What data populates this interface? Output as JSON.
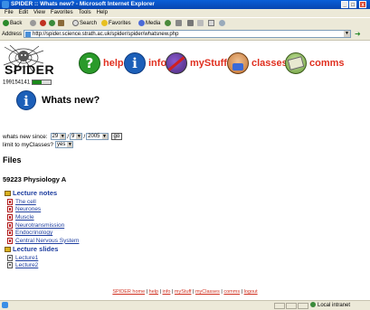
{
  "window": {
    "title": "SPIDER :: Whats new? - Microsoft Internet Explorer"
  },
  "menu": [
    "File",
    "Edit",
    "View",
    "Favorites",
    "Tools",
    "Help"
  ],
  "toolbar": {
    "back": "Back",
    "search": "Search",
    "favorites": "Favorites",
    "media": "Media"
  },
  "address": {
    "label": "Address",
    "url": "http://spider.science.strath.ac.uk/spider/spider/whatsnew.php"
  },
  "status": {
    "zone": "Local intranet"
  },
  "site": {
    "logo_text": "SPIDER",
    "user_id": "199154141",
    "nav": [
      {
        "label": "help",
        "icon": "help-icon"
      },
      {
        "label": "info",
        "icon": "info-icon"
      },
      {
        "label": "myStuff",
        "icon": "mystuff-icon"
      },
      {
        "label": "classes",
        "icon": "classes-icon"
      },
      {
        "label": "comms",
        "icon": "comms-icon"
      }
    ]
  },
  "page": {
    "title": "Whats new?"
  },
  "filter": {
    "since_label": "whats new since:",
    "day": "29",
    "month": "9",
    "year": "2005",
    "sep": "/",
    "go_label": "go",
    "limit_label": "limit to myClasses?",
    "limit_value": "yes"
  },
  "files": {
    "heading": "Files",
    "course": "59223 Physiology A",
    "sections": [
      {
        "label": "Lecture notes",
        "items": [
          "The cell",
          "Neurones",
          "Muscle",
          "Neurotransmission",
          "Endocrinology",
          "Central Nervous System"
        ]
      },
      {
        "label": "Lecture slides",
        "items": [
          "Lecture1",
          "Lecture2"
        ]
      }
    ]
  },
  "footer": {
    "sep": " | ",
    "links": [
      "SPIDER home",
      "help",
      "info",
      "myStuff",
      "myClasses",
      "comms",
      "logout"
    ]
  }
}
